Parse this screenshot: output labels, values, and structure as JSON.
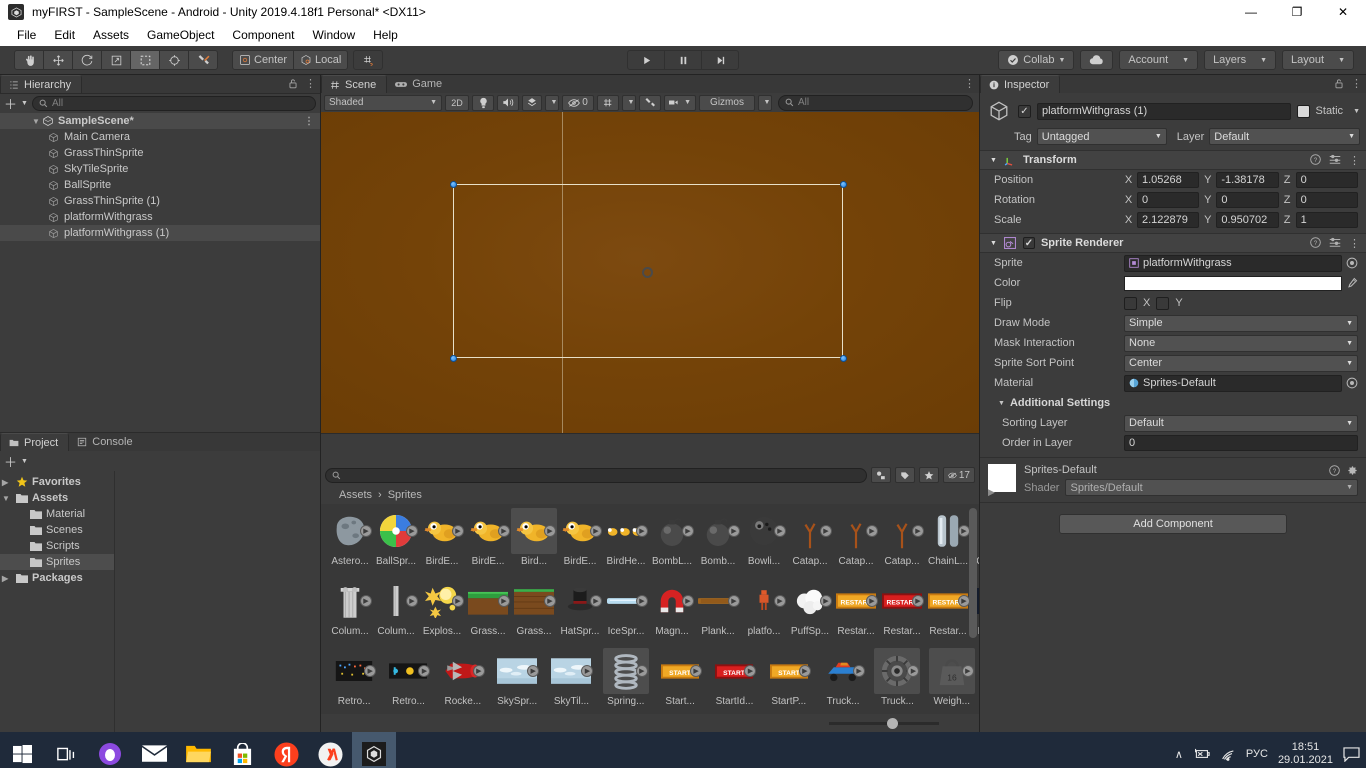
{
  "window": {
    "title": "myFIRST - SampleScene - Android - Unity 2019.4.18f1 Personal* <DX11>",
    "minimize": "—",
    "maximize": "❐",
    "close": "✕"
  },
  "menubar": {
    "items": [
      "File",
      "Edit",
      "Assets",
      "GameObject",
      "Component",
      "Window",
      "Help"
    ]
  },
  "toolbar": {
    "tools": [
      "hand-tool",
      "move-tool",
      "rotate-tool",
      "scale-tool",
      "rect-tool",
      "transform-tool",
      "custom-tool"
    ],
    "pivot_mode": "Center",
    "pivot_rotation": "Local",
    "play": "▶",
    "pause": "❙❙",
    "step": "▶|",
    "collab": "Collab",
    "cloud": "cloud-icon",
    "account": "Account",
    "layers": "Layers",
    "layout": "Layout"
  },
  "hierarchy": {
    "tab": "Hierarchy",
    "search_placeholder": "All",
    "scene_name": "SampleScene*",
    "items": [
      {
        "label": "Main Camera",
        "selected": false
      },
      {
        "label": "GrassThinSprite",
        "selected": false
      },
      {
        "label": "SkyTileSprite",
        "selected": false
      },
      {
        "label": "BallSprite",
        "selected": false
      },
      {
        "label": "GrassThinSprite (1)",
        "selected": false
      },
      {
        "label": "platformWithgrass",
        "selected": false
      },
      {
        "label": "platformWithgrass (1)",
        "selected": true
      }
    ]
  },
  "scene": {
    "tabs": [
      {
        "label": "Scene",
        "active": true
      },
      {
        "label": "Game",
        "active": false
      }
    ],
    "shading": "Shaded",
    "mode_2d": "2D",
    "audio": "audio-icon",
    "lighting": "lighting-icon",
    "fx": "fx-icon",
    "visibility_count": "0",
    "grid": "grid-icon",
    "tools": "tools-icon",
    "camera": "camera-icon",
    "gizmos": "Gizmos",
    "search_placeholder": "All"
  },
  "project": {
    "tabs": [
      {
        "label": "Project",
        "active": true
      },
      {
        "label": "Console",
        "active": false
      }
    ],
    "tree": [
      {
        "label": "Favorites",
        "indent": 0,
        "arrow": "▶",
        "icon": "star-icon",
        "selected": false
      },
      {
        "label": "Assets",
        "indent": 0,
        "arrow": "▼",
        "icon": "folder-icon",
        "selected": false
      },
      {
        "label": "Material",
        "indent": 1,
        "arrow": "",
        "icon": "folder-icon",
        "selected": false
      },
      {
        "label": "Scenes",
        "indent": 1,
        "arrow": "",
        "icon": "folder-icon",
        "selected": false
      },
      {
        "label": "Scripts",
        "indent": 1,
        "arrow": "",
        "icon": "folder-icon",
        "selected": false
      },
      {
        "label": "Sprites",
        "indent": 1,
        "arrow": "",
        "icon": "folder-icon",
        "selected": true
      },
      {
        "label": "Packages",
        "indent": 0,
        "arrow": "▶",
        "icon": "folder-icon",
        "selected": false
      }
    ],
    "search_placeholder": "",
    "filter_count": "17",
    "breadcrumb": [
      "Assets",
      "Sprites"
    ],
    "assets": [
      {
        "label": "Astero...",
        "kind": "asteroid",
        "selected": false
      },
      {
        "label": "BallSpr...",
        "kind": "ball",
        "selected": false
      },
      {
        "label": "BirdE...",
        "kind": "bird",
        "selected": false
      },
      {
        "label": "BirdE...",
        "kind": "bird",
        "selected": false
      },
      {
        "label": "Bird...",
        "kind": "bird",
        "selected": true
      },
      {
        "label": "BirdE...",
        "kind": "bird",
        "selected": false
      },
      {
        "label": "BirdHe...",
        "kind": "birds3",
        "selected": false
      },
      {
        "label": "BombL...",
        "kind": "bomb",
        "selected": false
      },
      {
        "label": "Bomb...",
        "kind": "bomb",
        "selected": false
      },
      {
        "label": "Bowli...",
        "kind": "bowling",
        "selected": false
      },
      {
        "label": "Catap...",
        "kind": "branch",
        "selected": false
      },
      {
        "label": "Catap...",
        "kind": "branch",
        "selected": false
      },
      {
        "label": "Catap...",
        "kind": "branch",
        "selected": false
      },
      {
        "label": "ChainL...",
        "kind": "chain",
        "selected": false
      },
      {
        "label": "CoinS...",
        "kind": "coin",
        "selected": false
      },
      {
        "label": "Colum...",
        "kind": "column",
        "selected": false
      },
      {
        "label": "Colum...",
        "kind": "columnthin",
        "selected": false
      },
      {
        "label": "Explos...",
        "kind": "explosion",
        "selected": false
      },
      {
        "label": "Grass...",
        "kind": "grassthin",
        "selected": false
      },
      {
        "label": "Grass...",
        "kind": "grassthick",
        "selected": false
      },
      {
        "label": "HatSpr...",
        "kind": "hat",
        "selected": false
      },
      {
        "label": "IceSpr...",
        "kind": "ice",
        "selected": false
      },
      {
        "label": "Magn...",
        "kind": "magnet",
        "selected": false
      },
      {
        "label": "Plank...",
        "kind": "plank",
        "selected": false
      },
      {
        "label": "platfo...",
        "kind": "platform",
        "selected": false
      },
      {
        "label": "PuffSp...",
        "kind": "puff",
        "selected": false
      },
      {
        "label": "Restar...",
        "kind": "restart-orange",
        "selected": false
      },
      {
        "label": "Restar...",
        "kind": "restart-red",
        "selected": false
      },
      {
        "label": "Restar...",
        "kind": "restart-orange",
        "selected": false
      },
      {
        "label": "Retro...",
        "kind": "retro-dots",
        "selected": false
      },
      {
        "label": "Retro...",
        "kind": "retro-blue",
        "selected": false
      },
      {
        "label": "Retro...",
        "kind": "retro-grid",
        "selected": false
      },
      {
        "label": "Rocke...",
        "kind": "rocket",
        "selected": false
      },
      {
        "label": "SkySpr...",
        "kind": "sky",
        "selected": false
      },
      {
        "label": "SkyTil...",
        "kind": "sky",
        "selected": false
      },
      {
        "label": "Spring...",
        "kind": "spring",
        "selected": true
      },
      {
        "label": "Start...",
        "kind": "start-orange",
        "selected": false
      },
      {
        "label": "StartId...",
        "kind": "start-red",
        "selected": false
      },
      {
        "label": "StartP...",
        "kind": "start-orange",
        "selected": false
      },
      {
        "label": "Truck...",
        "kind": "truck",
        "selected": false
      },
      {
        "label": "Truck...",
        "kind": "wheel",
        "selected": true
      },
      {
        "label": "Weigh...",
        "kind": "weight",
        "selected": true
      }
    ]
  },
  "inspector": {
    "tab": "Inspector",
    "object_name": "platformWithgrass (1)",
    "enabled": true,
    "static_label": "Static",
    "tag_label": "Tag",
    "tag_value": "Untagged",
    "layer_label": "Layer",
    "layer_value": "Default",
    "transform": {
      "title": "Transform",
      "rows": [
        {
          "label": "Position",
          "x": "1.05268",
          "y": "-1.38178",
          "z": "0"
        },
        {
          "label": "Rotation",
          "x": "0",
          "y": "0",
          "z": "0"
        },
        {
          "label": "Scale",
          "x": "2.122879",
          "y": "0.950702",
          "z": "1"
        }
      ]
    },
    "sprite_renderer": {
      "title": "Sprite Renderer",
      "sprite_label": "Sprite",
      "sprite_value": "platformWithgrass",
      "color_label": "Color",
      "color_value": "#FFFFFF",
      "flip_label": "Flip",
      "flip_x": "X",
      "flip_y": "Y",
      "draw_mode_label": "Draw Mode",
      "draw_mode_value": "Simple",
      "mask_label": "Mask Interaction",
      "mask_value": "None",
      "sort_point_label": "Sprite Sort Point",
      "sort_point_value": "Center",
      "material_label": "Material",
      "material_value": "Sprites-Default",
      "additional_label": "Additional Settings",
      "sorting_layer_label": "Sorting Layer",
      "sorting_layer_value": "Default",
      "order_label": "Order in Layer",
      "order_value": "0"
    },
    "material_preview": {
      "name": "Sprites-Default",
      "shader_label": "Shader",
      "shader_value": "Sprites/Default"
    },
    "add_component": "Add Component"
  },
  "taskbar": {
    "items": [
      "start-icon",
      "task-view-icon",
      "cortana-icon",
      "mail-icon",
      "explorer-icon",
      "store-icon",
      "yandex-browser-icon",
      "yandex-icon",
      "unity-icon"
    ],
    "tray": {
      "chevron": "∧",
      "power": "battery-icon",
      "network": "wifi-icon",
      "language": "РУС",
      "time": "18:51",
      "date": "29.01.2021",
      "notifications": "notification-icon"
    }
  }
}
